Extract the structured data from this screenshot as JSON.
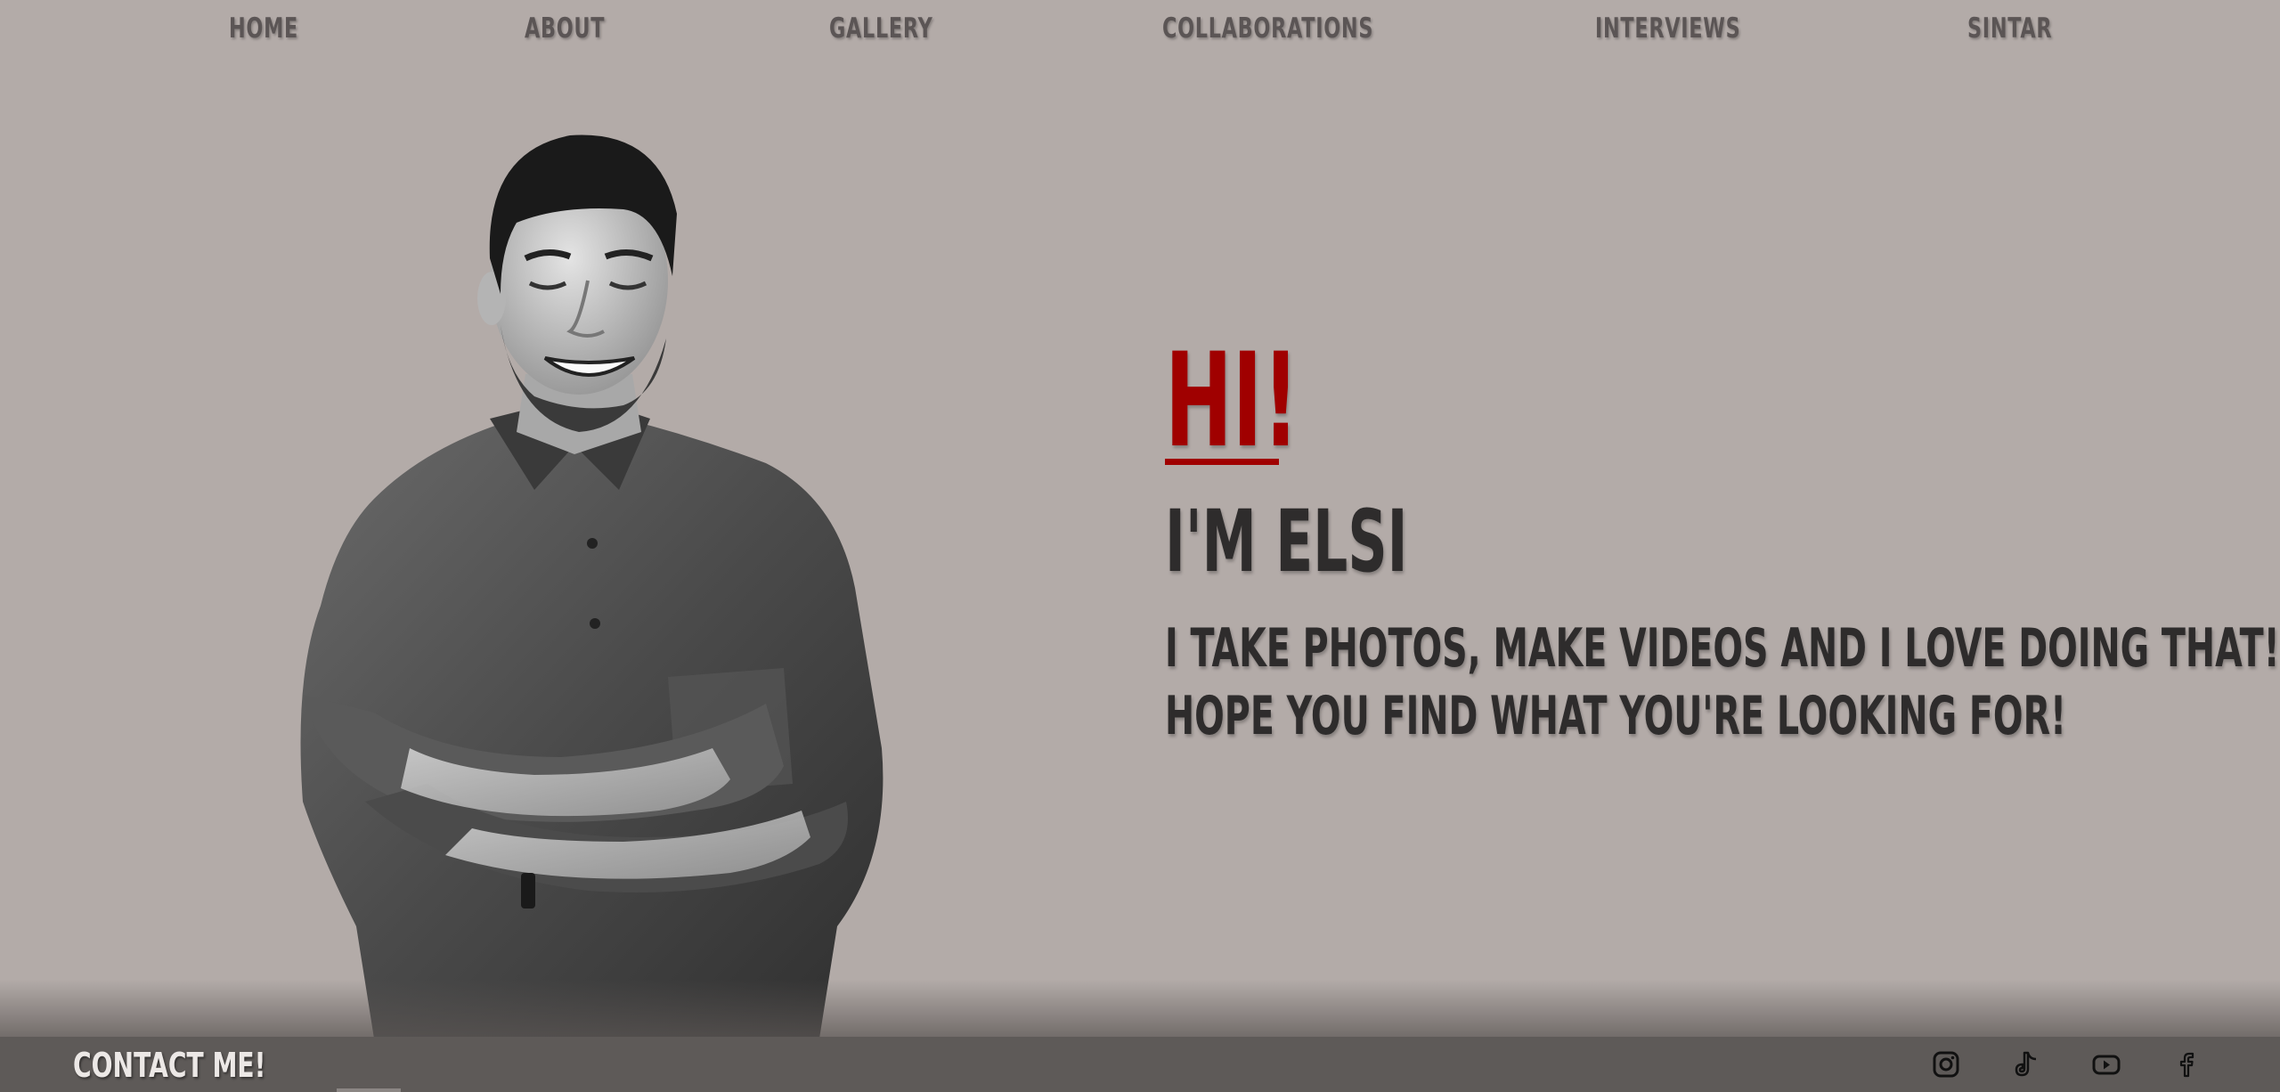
{
  "nav": {
    "items": [
      {
        "label": "HOME"
      },
      {
        "label": "ABOUT"
      },
      {
        "label": "GALLERY"
      },
      {
        "label": "COLLABORATIONS"
      },
      {
        "label": "INTERVIEWS"
      },
      {
        "label": "SINTAR"
      }
    ]
  },
  "hero": {
    "greeting": "HI!",
    "name_line": "I'M ELSI",
    "tagline_line1": "I TAKE PHOTOS, MAKE VIDEOS AND I LOVE DOING THAT!",
    "tagline_line2": "HOPE YOU FIND WHAT YOU'RE LOOKING FOR!"
  },
  "footer": {
    "contact_label": "CONTACT ME!",
    "social": [
      {
        "icon": "instagram-icon"
      },
      {
        "icon": "tiktok-icon"
      },
      {
        "icon": "youtube-icon"
      },
      {
        "icon": "facebook-icon"
      }
    ]
  },
  "colors": {
    "background": "#b3aba8",
    "accent": "#a00000",
    "text_dark": "#2e2c2c",
    "nav_text": "#5b5555",
    "footer_bg": "#5e5a58",
    "footer_text": "#ece8e6"
  }
}
